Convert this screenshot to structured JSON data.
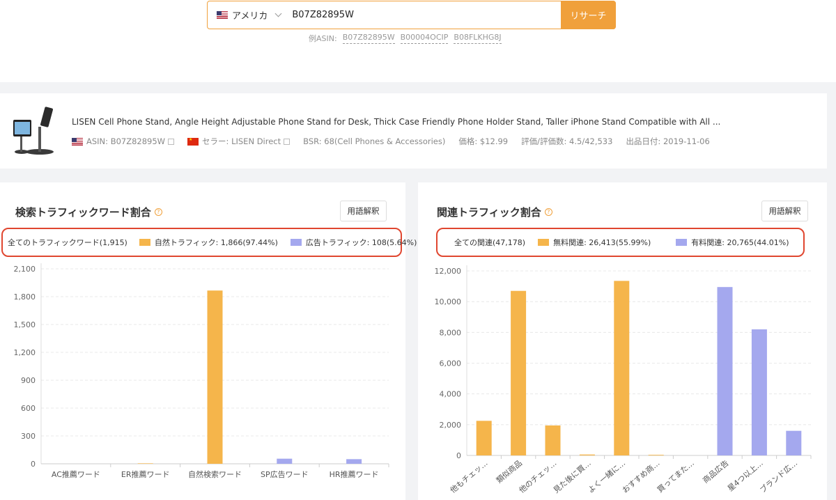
{
  "search": {
    "market": "アメリカ",
    "asin_value": "B07Z82895W",
    "button_label": "リサーチ",
    "examples_label": "例ASIN:",
    "examples": [
      "B07Z82895W",
      "B00004OCIP",
      "B08FLKHG8J"
    ]
  },
  "product": {
    "title": "LISEN Cell Phone Stand, Angle Height Adjustable Phone Stand for Desk, Thick Case Friendly Phone Holder Stand, Taller iPhone Stand Compatible with All ...",
    "asin": "ASIN: B07Z82895W",
    "seller": "セラー: LISEN Direct",
    "bsr": "BSR: 68(Cell Phones & Accessories)",
    "price": "価格: $12.99",
    "rating": "評価/評価数: 4.5/42,533",
    "date": "出品日付: 2019-11-06"
  },
  "left_panel": {
    "title": "検索トラフィックワード割合",
    "glossary_label": "用語解釈",
    "legend_total": "全てのトラフィックワード(1,915)",
    "legend_organic": "自然トラフィック: 1,866(97.44%)",
    "legend_ad": "広告トラフィック: 108(5.64%)"
  },
  "right_panel": {
    "title": "関連トラフィック割合",
    "glossary_label": "用語解釈",
    "legend_total": "全ての関連(47,178)",
    "legend_free": "無料関連: 26,413(55.99%)",
    "legend_paid": "有料関連: 20,765(44.01%)"
  },
  "colors": {
    "accent": "#f0a03b",
    "bar_orange": "#f5b54b",
    "bar_purple": "#a4a8ee",
    "highlight": "#e0462f"
  },
  "chart_data": [
    {
      "type": "bar",
      "categories": [
        "AC推薦ワード",
        "ER推薦ワード",
        "自然検索ワード",
        "SP広告ワード",
        "HR推薦ワード"
      ],
      "values": [
        0,
        5,
        1866,
        55,
        50
      ],
      "series_kind": [
        "organic",
        "organic",
        "organic",
        "ad",
        "ad"
      ],
      "ylim": [
        0,
        2100
      ],
      "yticks": [
        "0",
        "300",
        "600",
        "900",
        "1,200",
        "1,500",
        "1,800",
        "2,100"
      ],
      "grid": true
    },
    {
      "type": "bar",
      "categories": [
        "他もチェッ…",
        "類似商品",
        "他のチェッ…",
        "見た後に買…",
        "よく一緒に…",
        "おすすめ商…",
        "買ってまた…",
        "商品広告",
        "星4つ以上…",
        "ブランド広…"
      ],
      "values": [
        2250,
        10700,
        1950,
        60,
        11350,
        40,
        0,
        10950,
        8200,
        1600
      ],
      "series_kind": [
        "free",
        "free",
        "free",
        "free",
        "free",
        "free",
        "free",
        "paid",
        "paid",
        "paid"
      ],
      "ylim": [
        0,
        12000
      ],
      "yticks": [
        "0",
        "2,000",
        "4,000",
        "6,000",
        "8,000",
        "10,000",
        "12,000"
      ],
      "grid": true
    }
  ]
}
